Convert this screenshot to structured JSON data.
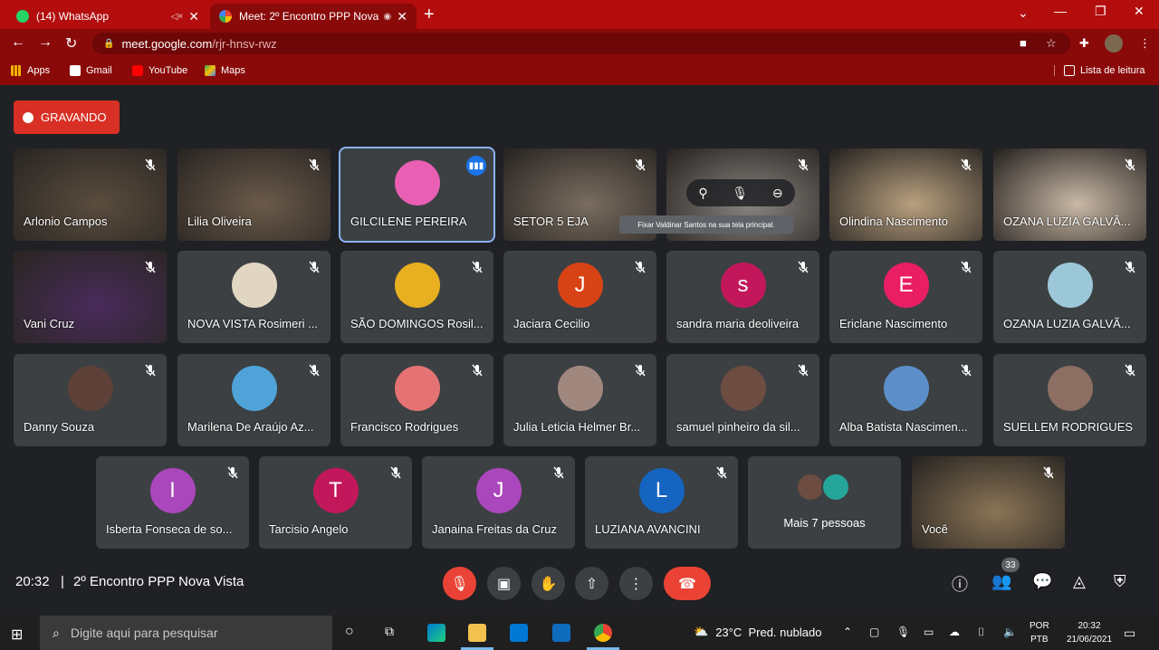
{
  "browser": {
    "tabs": [
      {
        "title": "(14) WhatsApp",
        "active": false,
        "favicon_color": "#25d366"
      },
      {
        "title": "Meet: 2º Encontro PPP Nova",
        "active": true,
        "favicon_color": "#00897b"
      }
    ],
    "url_host": "meet.google.com",
    "url_path": "/rjr-hnsv-rwz",
    "bookmarks": [
      {
        "label": "Apps",
        "icon": "apps-grid-icon",
        "color": "#f4b400"
      },
      {
        "label": "Gmail",
        "icon": "gmail-icon",
        "color": "#ffffff"
      },
      {
        "label": "YouTube",
        "icon": "youtube-icon",
        "color": "#ff0000"
      },
      {
        "label": "Maps",
        "icon": "maps-icon",
        "color": "#34a853"
      }
    ],
    "reading_list": "Lista de leitura"
  },
  "meet": {
    "recording_label": "GRAVANDO",
    "participants": [
      {
        "name": "Arlonio Campos",
        "type": "video",
        "bg": "#5a4d3e"
      },
      {
        "name": "Lilia Oliveira",
        "type": "video",
        "bg": "#6b5a4a"
      },
      {
        "name": "GILCILENE PEREIRA",
        "type": "avatar-photo",
        "bg": "#e85fb4",
        "speaking": true
      },
      {
        "name": "SETOR 5 EJA",
        "type": "video",
        "bg": "#7a6d60"
      },
      {
        "name": "",
        "type": "video",
        "bg": "#8a8580"
      },
      {
        "name": "Olindina Nascimento",
        "type": "video",
        "bg": "#b8a07e"
      },
      {
        "name": "OZANA LUZIA GALVÃ...",
        "type": "video",
        "bg": "#c9b8a6"
      },
      {
        "name": "Vani Cruz",
        "type": "video",
        "bg": "#4a2b5c"
      },
      {
        "name": "NOVA VISTA Rosimeri ...",
        "type": "avatar-photo",
        "bg": "#e0d6c2"
      },
      {
        "name": "SÃO DOMINGOS Rosil...",
        "type": "avatar-photo",
        "bg": "#e8b020"
      },
      {
        "name": "Jaciara Cecilio",
        "type": "initial",
        "initial": "J",
        "bg": "#d84315"
      },
      {
        "name": "sandra maria deoliveira",
        "type": "initial",
        "initial": "s",
        "bg": "#c2185b"
      },
      {
        "name": "Ericlane Nascimento",
        "type": "initial",
        "initial": "E",
        "bg": "#e91e63"
      },
      {
        "name": "OZANA LUZIA GALVÃ...",
        "type": "avatar-photo",
        "bg": "#9cc7d9"
      },
      {
        "name": "Danny Souza",
        "type": "avatar-photo",
        "bg": "#5d4037"
      },
      {
        "name": "Marilena De Araújo Az...",
        "type": "avatar-photo",
        "bg": "#4fa3d9"
      },
      {
        "name": "Francisco Rodrigues",
        "type": "avatar-photo",
        "bg": "#e57373"
      },
      {
        "name": "Julia Leticia Helmer Br...",
        "type": "avatar-photo",
        "bg": "#a1887f"
      },
      {
        "name": "samuel pinheiro da sil...",
        "type": "avatar-photo",
        "bg": "#6d4c41"
      },
      {
        "name": "Alba Batista Nascimen...",
        "type": "avatar-photo",
        "bg": "#5c8fc9"
      },
      {
        "name": "SUELLEM RODRIGUES",
        "type": "avatar-photo",
        "bg": "#8d6e63"
      },
      {
        "name": "Isberta Fonseca de so...",
        "type": "initial",
        "initial": "I",
        "bg": "#ab47bc"
      },
      {
        "name": "Tarcisio Angelo",
        "type": "initial",
        "initial": "T",
        "bg": "#c2185b"
      },
      {
        "name": "Janaina Freitas da Cruz",
        "type": "initial",
        "initial": "J",
        "bg": "#ab47bc"
      },
      {
        "name": "LUZIANA AVANCINI",
        "type": "initial",
        "initial": "L",
        "bg": "#1565c0"
      },
      {
        "name": "Você",
        "type": "video",
        "bg": "#8a7455"
      }
    ],
    "more_people": "Mais 7 pessoas",
    "pin_tooltip": "Fixar Valdinar Santos na sua tela principal.",
    "time": "20:32",
    "separator": "|",
    "meeting_name": "2º Encontro PPP Nova Vista",
    "participant_count": "33"
  },
  "taskbar": {
    "search_placeholder": "Digite aqui para pesquisar",
    "temperature": "23°C",
    "weather": "Pred. nublado",
    "lang_top": "POR",
    "lang_bottom": "PTB",
    "clock_time": "20:32",
    "clock_date": "21/06/2021"
  }
}
